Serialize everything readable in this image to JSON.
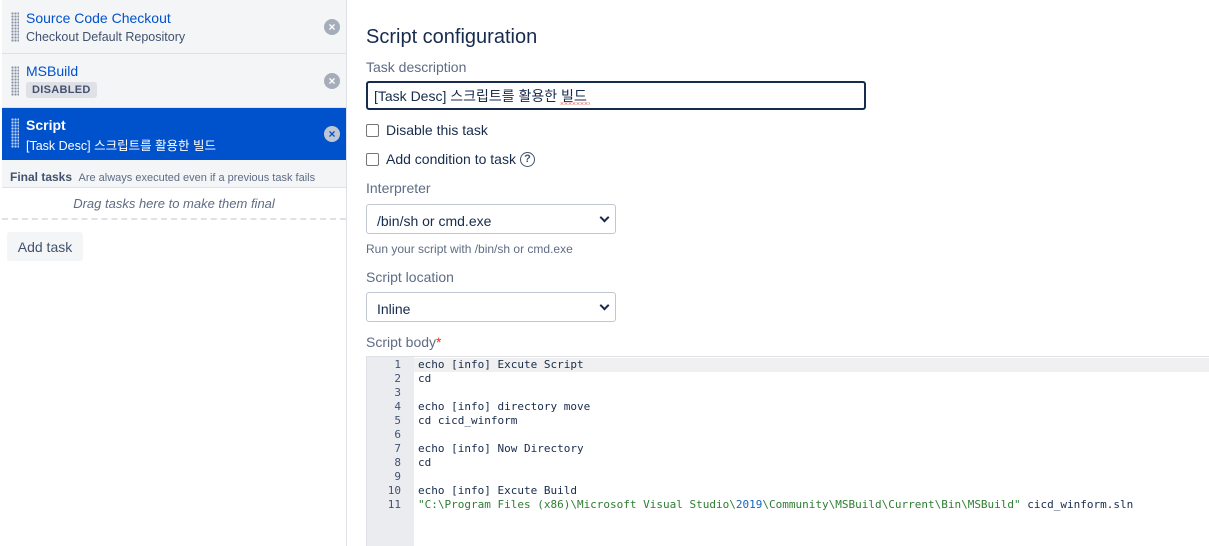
{
  "tasks": [
    {
      "name": "Source Code Checkout",
      "description": "Checkout Default Repository",
      "remove_icon": "x-circle-icon"
    },
    {
      "name": "MSBuild",
      "badge": "DISABLED",
      "remove_icon": "x-circle-icon"
    },
    {
      "name": "Script",
      "description": "[Task Desc] 스크립트를 활용한 빌드",
      "remove_icon": "x-circle-icon",
      "selected": true
    }
  ],
  "final_tasks": {
    "title": "Final tasks",
    "note": "Are always executed even if a previous task fails",
    "drop_hint": "Drag tasks here to make them final"
  },
  "add_task_label": "Add task",
  "config": {
    "title": "Script configuration",
    "task_description_label": "Task description",
    "task_description_value": "[Task Desc] 스크립트를 활용한 빌드",
    "disable_label": "Disable this task",
    "condition_label": "Add condition to task",
    "help_icon": "?",
    "interpreter_label": "Interpreter",
    "interpreter_value": "/bin/sh or cmd.exe",
    "interpreter_help": "Run your script with /bin/sh or cmd.exe",
    "location_label": "Script location",
    "location_value": "Inline",
    "body_label": "Script body",
    "required_mark": "*"
  },
  "script_lines": [
    {
      "n": "1",
      "text": "echo [info] Excute Script"
    },
    {
      "n": "2",
      "text": "cd"
    },
    {
      "n": "3",
      "text": ""
    },
    {
      "n": "4",
      "text": "echo [info] directory move"
    },
    {
      "n": "5",
      "text": "cd cicd_winform"
    },
    {
      "n": "6",
      "text": ""
    },
    {
      "n": "7",
      "text": "echo [info] Now Directory"
    },
    {
      "n": "8",
      "text": "cd"
    },
    {
      "n": "9",
      "text": ""
    },
    {
      "n": "10",
      "text": "echo [info] Excute Build"
    },
    {
      "n": "11",
      "text": "\"C:\\Program Files (x86)\\Microsoft Visual Studio\\2019\\Community\\MSBuild\\Current\\Bin\\MSBuild\" cicd_winform.sln"
    }
  ],
  "colors": {
    "accent": "#0052cc",
    "required": "#de350b",
    "string": "#2e7d32",
    "number": "#1565c0"
  }
}
